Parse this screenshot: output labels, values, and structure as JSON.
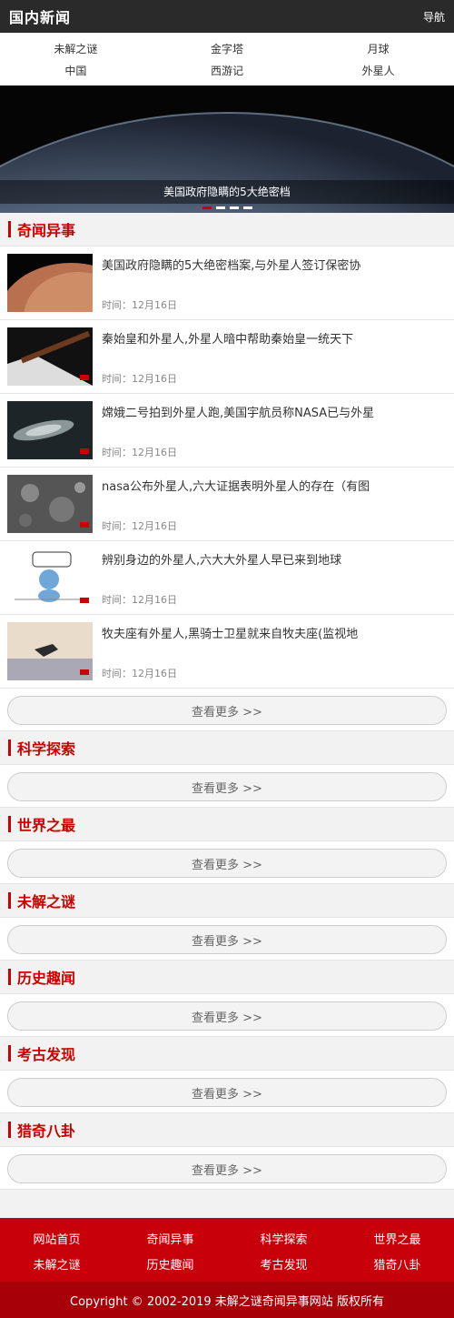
{
  "header": {
    "logo": "国内新闻",
    "nav_button": "导航"
  },
  "categories": [
    "未解之谜",
    "金字塔",
    "月球",
    "中国",
    "西游记",
    "外星人"
  ],
  "banner": {
    "caption": "美国政府隐瞒的5大绝密档",
    "slides": 4,
    "active_slide": 1
  },
  "sections": [
    {
      "title": "奇闻异事",
      "items": [
        {
          "title": "美国政府隐瞒的5大绝密档案,与外星人签订保密协",
          "date": "时间：12月16日",
          "thumb": "planet-thumbnail"
        },
        {
          "title": "秦始皇和外星人,外星人暗中帮助秦始皇一统天下",
          "date": "时间：12月16日",
          "thumb": "sword-thumbnail"
        },
        {
          "title": "嫦娥二号拍到外星人跑,美国宇航员称NASA已与外星",
          "date": "时间：12月16日",
          "thumb": "spacecraft-thumbnail"
        },
        {
          "title": "nasa公布外星人,六大证据表明外星人的存在（有图",
          "date": "时间：12月16日",
          "thumb": "moon-surface-thumbnail"
        },
        {
          "title": "辨别身边的外星人,六大大外星人早已来到地球",
          "date": "时间：12月16日",
          "thumb": "cartoon-alien-thumbnail"
        },
        {
          "title": "牧夫座有外星人,黑骑士卫星就来自牧夫座(监视地",
          "date": "时间：12月16日",
          "thumb": "satellite-thumbnail"
        }
      ],
      "more": "查看更多 >>"
    },
    {
      "title": "科学探索",
      "more": "查看更多 >>"
    },
    {
      "title": "世界之最",
      "more": "查看更多 >>"
    },
    {
      "title": "未解之谜",
      "more": "查看更多 >>"
    },
    {
      "title": "历史趣闻",
      "more": "查看更多 >>"
    },
    {
      "title": "考古发现",
      "more": "查看更多 >>"
    },
    {
      "title": "猎奇八卦",
      "more": "查看更多 >>"
    }
  ],
  "footer": {
    "links": [
      "网站首页",
      "奇闻异事",
      "科学探索",
      "世界之最",
      "未解之谜",
      "历史趣闻",
      "考古发现",
      "猎奇八卦"
    ],
    "copyright": "Copyright © 2002-2019 未解之谜奇闻异事网站 版权所有"
  },
  "colors": {
    "accent": "#c8000a",
    "topbar": "#2a2a2a",
    "background": "#f2f2f2"
  }
}
